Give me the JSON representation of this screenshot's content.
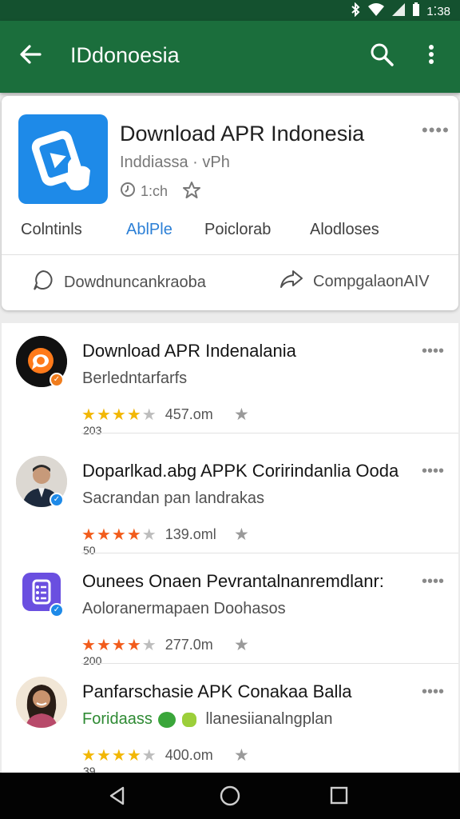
{
  "status": {
    "time": "1⁚38"
  },
  "appbar": {
    "title": "IDdonoesia"
  },
  "app_card": {
    "title": "Download APR Indonesia",
    "publisher": "Inddiassa · vPh",
    "meta": "1:ch",
    "tabs": [
      "Colntinls",
      "AblPle",
      "Poiclorab",
      "Alodloses"
    ],
    "active_tab": "AblPle",
    "actions": [
      "Dowdnuncankraoba",
      "CompgalaonAIV"
    ]
  },
  "list": {
    "items": [
      {
        "name": "Download APR Indenalania",
        "sub": "Berledntarfarfs",
        "rating": 4,
        "size": "457.om",
        "count": "203"
      },
      {
        "name": "Doparlkad.abg APPK Coririndanlia Ooda",
        "sub": "Sacrandan pan landrakas",
        "rating": 4,
        "size": "139.oml",
        "count": "50"
      },
      {
        "name": "Ounees Onaen Pevrantalnanremdlanr:",
        "sub": "Aoloranermapaen Doohasos",
        "rating": 4,
        "size": "277.0m",
        "count": "200"
      },
      {
        "name": "Panfarschasie APK Conakaa Balla",
        "sub_green": "Foridaass",
        "sub_rest": "llanesiianalngplan",
        "rating": 4,
        "size": "400.om",
        "count": "39"
      }
    ]
  },
  "colors": {
    "appbar": "#1b6e3c",
    "statusbar": "#14512f",
    "accent_blue": "#2b7fd6",
    "star_gold": "#f2b705",
    "star_orange": "#f25c1c"
  }
}
